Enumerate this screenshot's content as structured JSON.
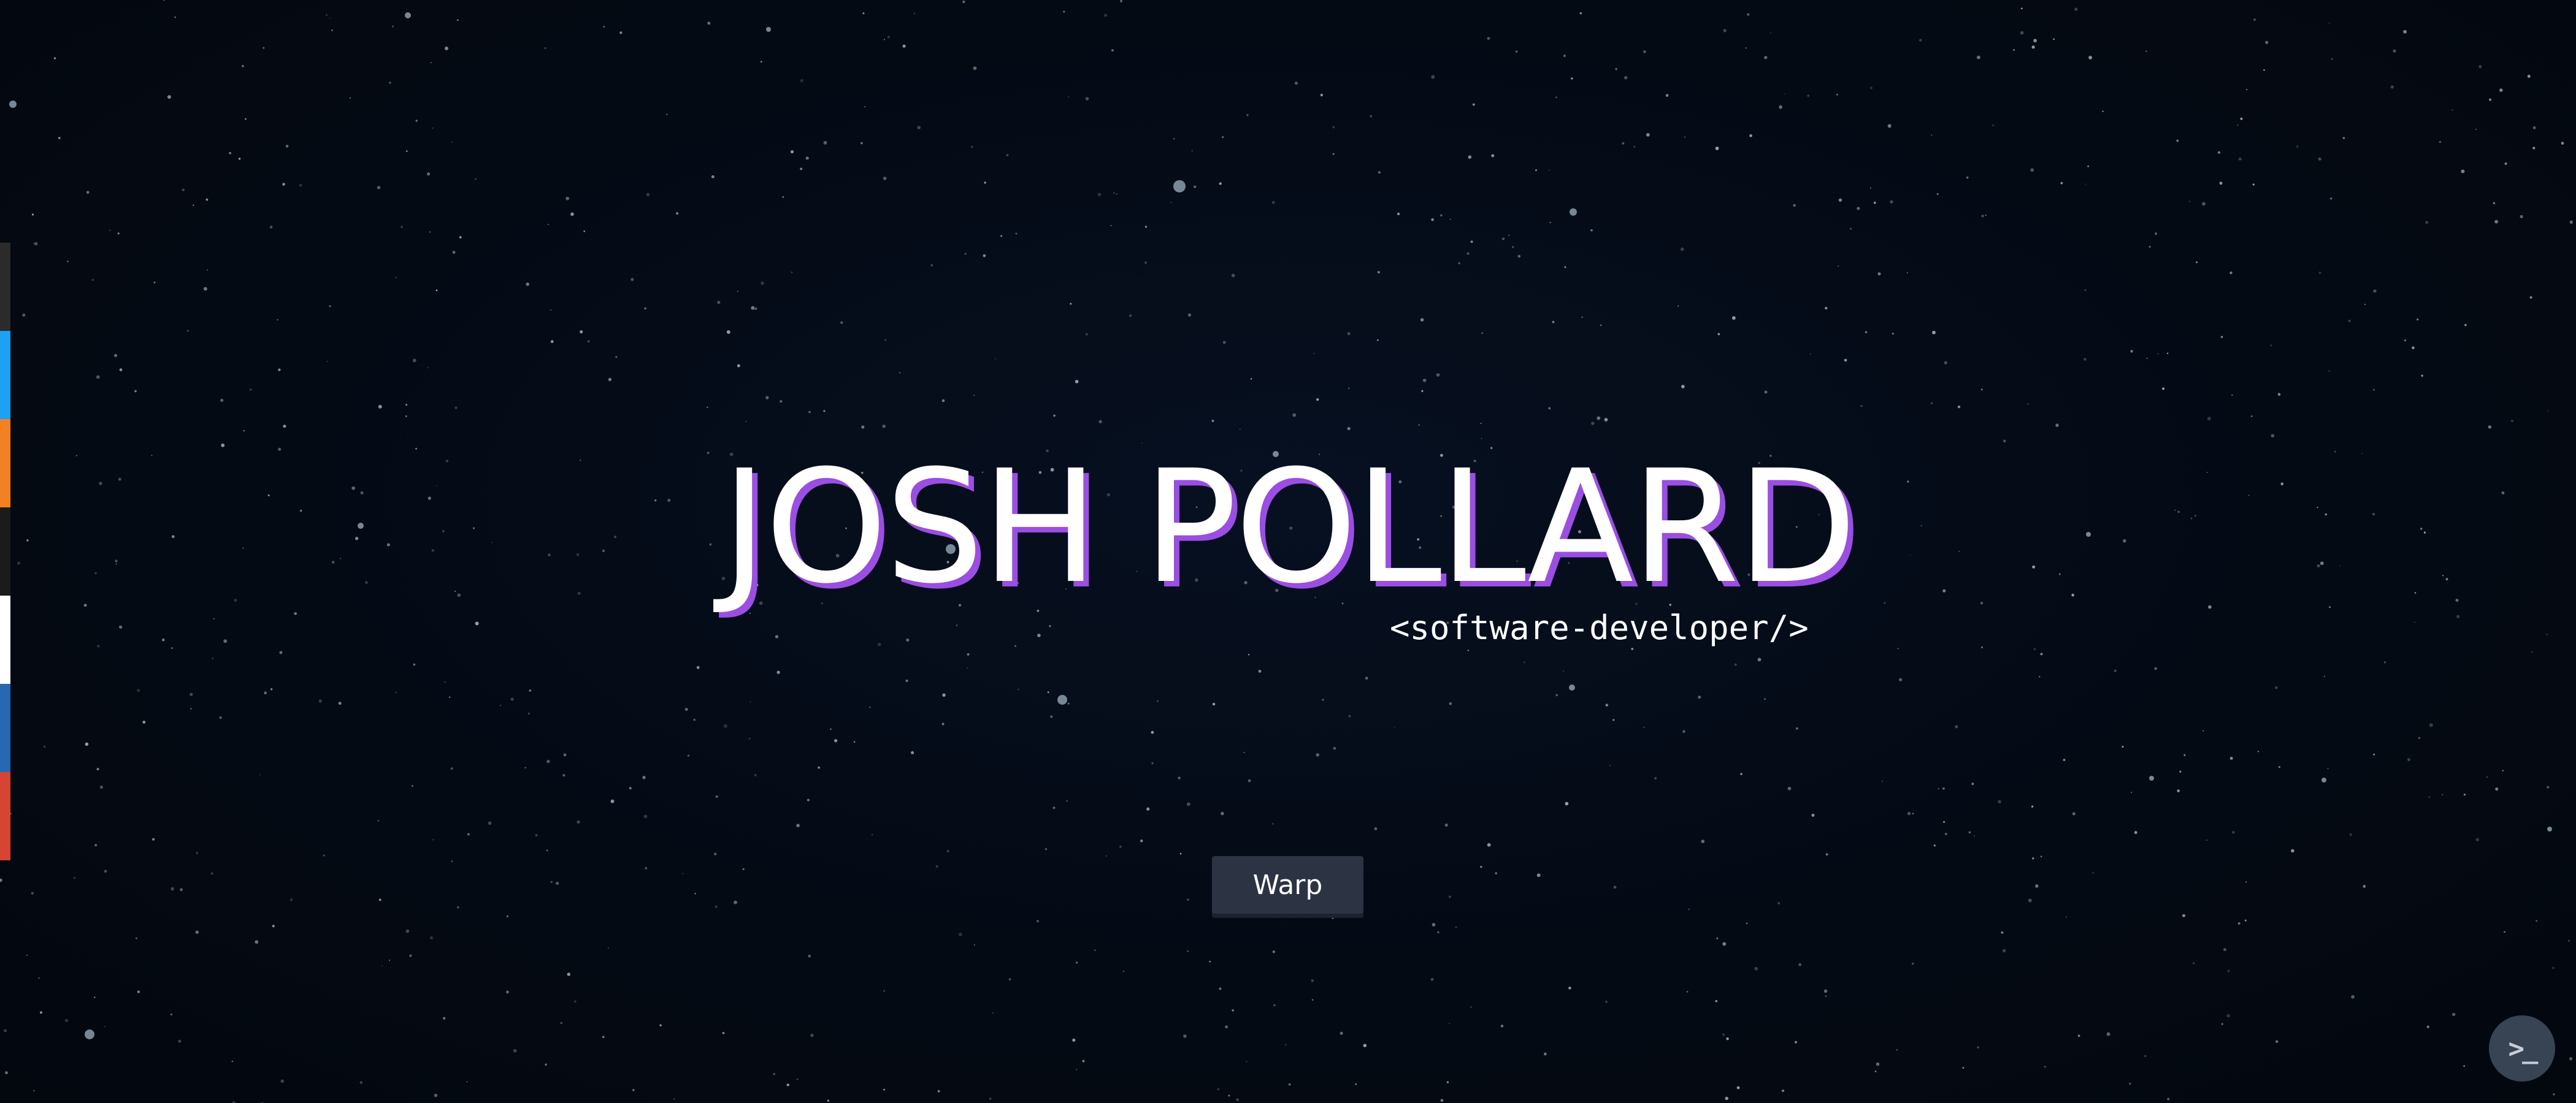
{
  "hero": {
    "name": "JOSH POLLARD",
    "tagline": "<software-developer/>",
    "name_color": "#ffffff",
    "name_shadow_color": "#9a4ee2"
  },
  "warp_button": {
    "label": "Warp"
  },
  "terminal_button": {
    "icon": "terminal-prompt-icon",
    "glyph": ">_"
  },
  "social_links": [
    {
      "icon": "github-icon",
      "color": "#2b2b2b"
    },
    {
      "icon": "twitter-icon",
      "color": "#1da1f2"
    },
    {
      "icon": "stackoverflow-icon",
      "color": "#f48024"
    },
    {
      "icon": "codepen-icon",
      "color": "#1b1b1b"
    },
    {
      "icon": "medium-icon",
      "color": "#ffffff"
    },
    {
      "icon": "linkedin-icon",
      "color": "#2867b2"
    },
    {
      "icon": "email-icon",
      "color": "#d64533"
    }
  ],
  "colors": {
    "background": "#040a14",
    "accent": "#9a4ee2",
    "button": "#2c3444"
  }
}
